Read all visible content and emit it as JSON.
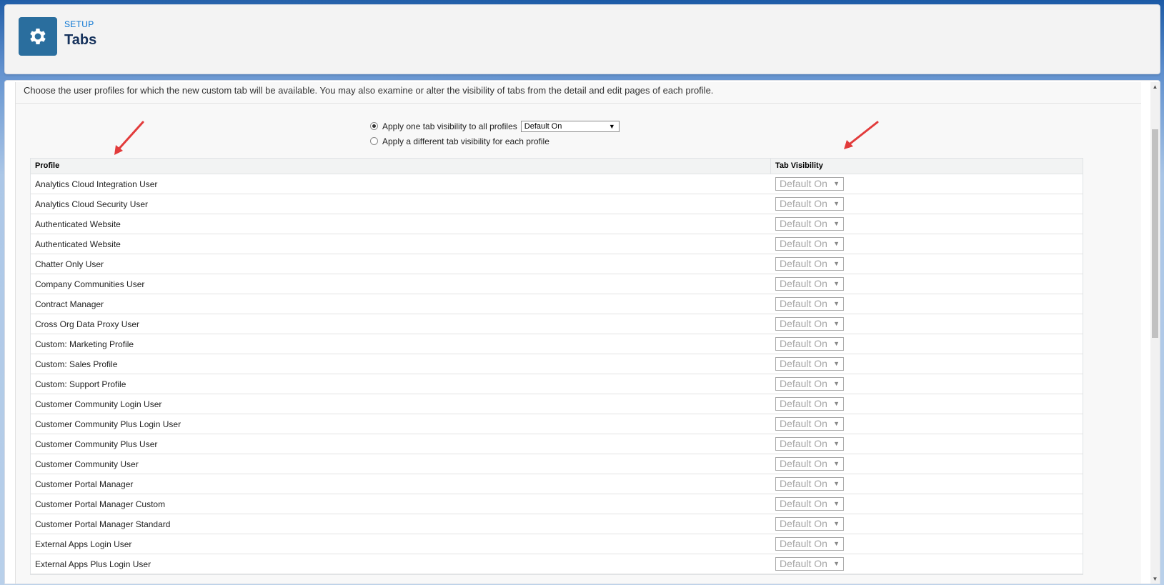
{
  "header": {
    "breadcrumb": "SETUP",
    "title": "Tabs",
    "icon": "gear-icon"
  },
  "instructions": "Choose the user profiles for which the new custom tab will be available. You may also examine or alter the visibility of tabs from the detail and edit pages of each profile.",
  "options": {
    "apply_all_label": "Apply one tab visibility to all profiles",
    "apply_all_selected": true,
    "apply_all_value": "Default On",
    "apply_each_label": "Apply a different tab visibility for each profile",
    "apply_each_selected": false
  },
  "table": {
    "columns": [
      "Profile",
      "Tab Visibility"
    ],
    "rows": [
      {
        "profile": "Analytics Cloud Integration User",
        "visibility": "Default On"
      },
      {
        "profile": "Analytics Cloud Security User",
        "visibility": "Default On"
      },
      {
        "profile": "Authenticated Website",
        "visibility": "Default On"
      },
      {
        "profile": "Authenticated Website",
        "visibility": "Default On"
      },
      {
        "profile": "Chatter Only User",
        "visibility": "Default On"
      },
      {
        "profile": "Company Communities User",
        "visibility": "Default On"
      },
      {
        "profile": "Contract Manager",
        "visibility": "Default On"
      },
      {
        "profile": "Cross Org Data Proxy User",
        "visibility": "Default On"
      },
      {
        "profile": "Custom: Marketing Profile",
        "visibility": "Default On"
      },
      {
        "profile": "Custom: Sales Profile",
        "visibility": "Default On"
      },
      {
        "profile": "Custom: Support Profile",
        "visibility": "Default On"
      },
      {
        "profile": "Customer Community Login User",
        "visibility": "Default On"
      },
      {
        "profile": "Customer Community Plus Login User",
        "visibility": "Default On"
      },
      {
        "profile": "Customer Community Plus User",
        "visibility": "Default On"
      },
      {
        "profile": "Customer Community User",
        "visibility": "Default On"
      },
      {
        "profile": "Customer Portal Manager",
        "visibility": "Default On"
      },
      {
        "profile": "Customer Portal Manager Custom",
        "visibility": "Default On"
      },
      {
        "profile": "Customer Portal Manager Standard",
        "visibility": "Default On"
      },
      {
        "profile": "External Apps Login User",
        "visibility": "Default On"
      },
      {
        "profile": "External Apps Plus Login User",
        "visibility": "Default On"
      }
    ]
  },
  "colors": {
    "accent": "#2a6e9e",
    "link": "#0070d2",
    "annotation_arrow": "#e23b3b"
  }
}
